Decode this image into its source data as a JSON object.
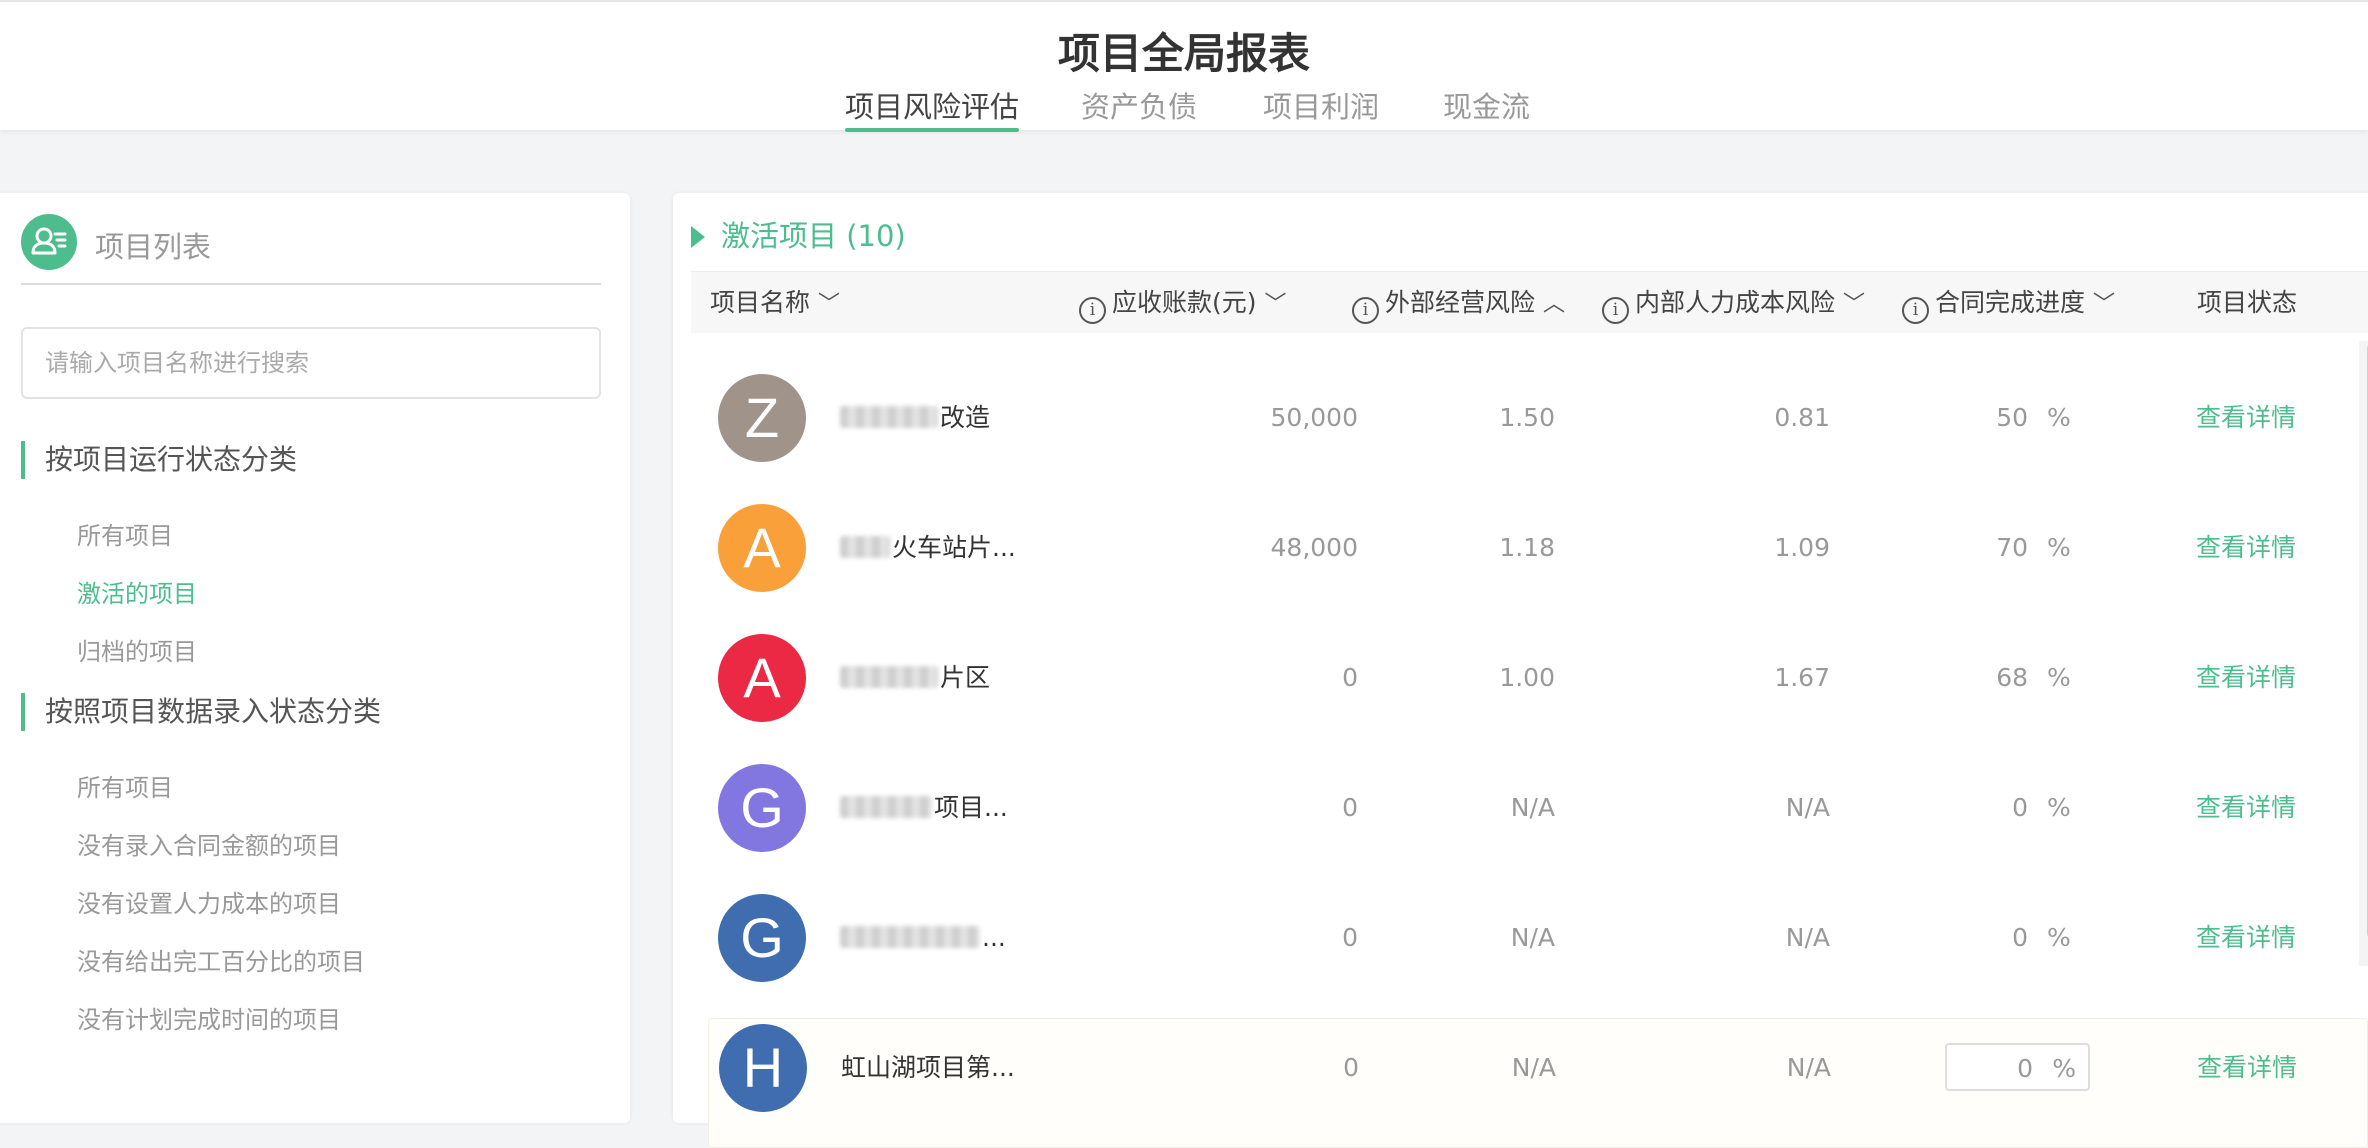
{
  "header": {
    "title": "项目全局报表",
    "tabs": [
      {
        "label": "项目风险评估",
        "active": true
      },
      {
        "label": "资产负债",
        "active": false
      },
      {
        "label": "项目利润",
        "active": false
      },
      {
        "label": "现金流",
        "active": false
      }
    ]
  },
  "sidebar": {
    "title": "项目列表",
    "search_placeholder": "请输入项目名称进行搜索",
    "group1": {
      "label": "按项目运行状态分类",
      "items": [
        "所有项目",
        "激活的项目",
        "归档的项目"
      ]
    },
    "group2": {
      "label": "按照项目数据录入状态分类",
      "items": [
        "所有项目",
        "没有录入合同金额的项目",
        "没有设置人力成本的项目",
        "没有给出完工百分比的项目",
        "没有计划完成时间的项目"
      ]
    },
    "active_item": "激活的项目"
  },
  "main": {
    "section_title": "激活项目 (10)",
    "columns": [
      "项目名称",
      "应收账款(元)",
      "外部经营风险",
      "内部人力成本风险",
      "合同完成进度",
      "项目状态"
    ],
    "rows": [
      {
        "initial": "Z",
        "color": "#a0938a",
        "name": "改造",
        "receivable": "50,000",
        "external_risk": "1.50",
        "internal_risk": "0.81",
        "progress": "50",
        "unit": "%",
        "action": "查看详情"
      },
      {
        "initial": "A",
        "color": "#f9a03a",
        "name": "火车站片...",
        "receivable": "48,000",
        "external_risk": "1.18",
        "internal_risk": "1.09",
        "progress": "70",
        "unit": "%",
        "action": "查看详情"
      },
      {
        "initial": "A",
        "color": "#ec2945",
        "name": "片区",
        "receivable": "0",
        "external_risk": "1.00",
        "internal_risk": "1.67",
        "progress": "68",
        "unit": "%",
        "action": "查看详情"
      },
      {
        "initial": "G",
        "color": "#8277e1",
        "name": "项目...",
        "receivable": "0",
        "external_risk": "N/A",
        "internal_risk": "N/A",
        "progress": "0",
        "unit": "%",
        "action": "查看详情"
      },
      {
        "initial": "G",
        "color": "#3f6db0",
        "name": "...",
        "receivable": "0",
        "external_risk": "N/A",
        "internal_risk": "N/A",
        "progress": "0",
        "unit": "%",
        "action": "查看详情"
      },
      {
        "initial": "H",
        "color": "#3f6db0",
        "name": "虹山湖项目第...",
        "receivable": "0",
        "external_risk": "N/A",
        "internal_risk": "N/A",
        "progress": "0",
        "unit": "%",
        "action": "查看详情"
      }
    ]
  },
  "colors": {
    "accent": "#4dbd8e"
  }
}
